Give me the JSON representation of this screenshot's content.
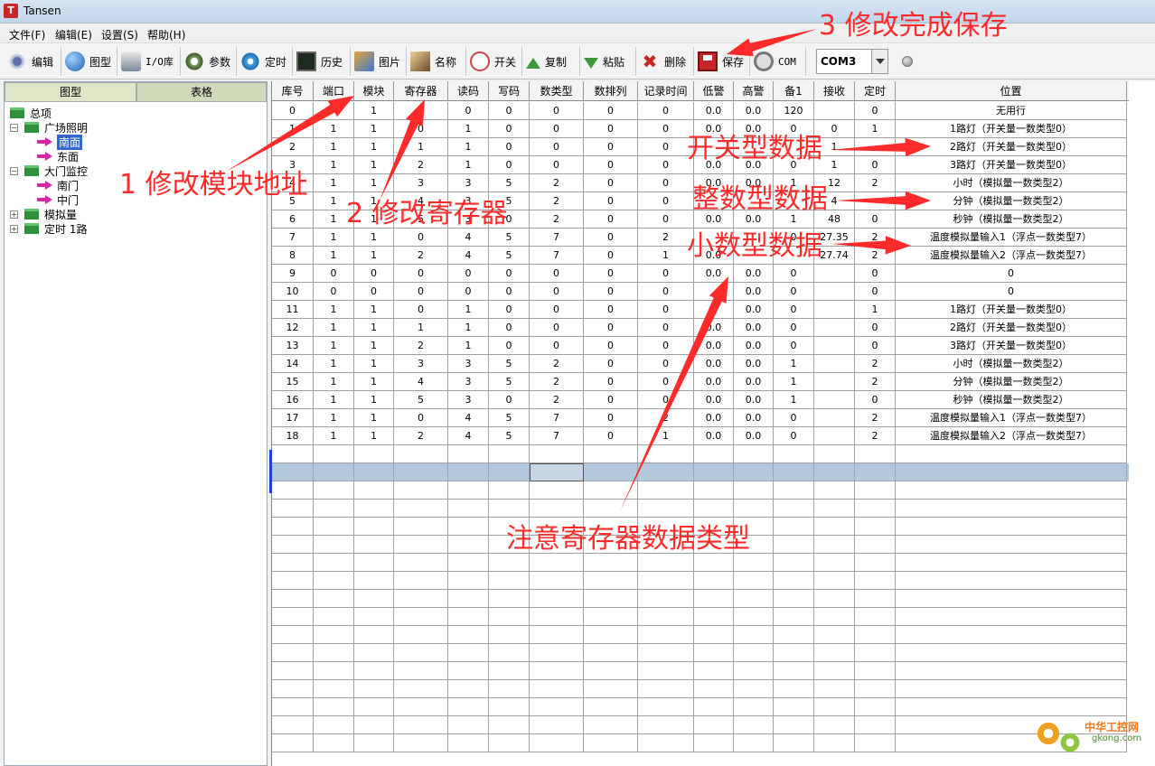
{
  "window": {
    "title": "Tansen",
    "app_icon_letter": "T"
  },
  "menu": [
    "文件(F)",
    "编辑(E)",
    "设置(S)",
    "帮助(H)"
  ],
  "toolbar": {
    "edit": "编辑",
    "diagram": "图型",
    "io_lib": "I/O库",
    "params": "参数",
    "timer": "定时",
    "history": "历史",
    "picture": "图片",
    "name": "名称",
    "switch": "开关",
    "copy": "复制",
    "paste": "粘贴",
    "delete": "删除",
    "save": "保存",
    "com": "COM",
    "com_port_value": "COM3"
  },
  "left_panel": {
    "tabs": {
      "diagram": "图型",
      "table": "表格"
    },
    "tree": {
      "root": "总项",
      "group1": "广场照明",
      "g1_child1": "南面",
      "g1_child2": "东面",
      "group2": "大门监控",
      "g2_child1": "南门",
      "g2_child2": "中门",
      "group3": "模拟量",
      "group4": "定时 1路"
    }
  },
  "table": {
    "columns": [
      "库号",
      "端口",
      "模块",
      "寄存器",
      "读码",
      "写码",
      "数类型",
      "数排列",
      "记录时间",
      "低警",
      "高警",
      "备1",
      "接收",
      "定时",
      "位置"
    ],
    "rows": [
      [
        "0",
        "",
        "1",
        "0",
        "0",
        "0",
        "0",
        "0",
        "0",
        "0.0",
        "0.0",
        "120",
        "",
        "0",
        "无用行"
      ],
      [
        "1",
        "1",
        "1",
        "0",
        "1",
        "0",
        "0",
        "0",
        "0",
        "0.0",
        "0.0",
        "0",
        "0",
        "1",
        "1路灯（开关量一数类型0）"
      ],
      [
        "2",
        "1",
        "1",
        "1",
        "1",
        "0",
        "0",
        "0",
        "0",
        "",
        "",
        "",
        "1",
        "",
        "2路灯（开关量一数类型0）"
      ],
      [
        "3",
        "1",
        "1",
        "2",
        "1",
        "0",
        "0",
        "0",
        "0",
        "0.0",
        "0.0",
        "0",
        "1",
        "0",
        "3路灯（开关量一数类型0）"
      ],
      [
        "4",
        "1",
        "1",
        "3",
        "3",
        "5",
        "2",
        "0",
        "0",
        "0.0",
        "0.0",
        "1",
        "12",
        "2",
        "小时（模拟量一数类型2）"
      ],
      [
        "5",
        "1",
        "1",
        "4",
        "3",
        "5",
        "2",
        "0",
        "0",
        "",
        "",
        "",
        "4",
        "",
        "分钟（模拟量一数类型2）"
      ],
      [
        "6",
        "1",
        "1",
        "5",
        "3",
        "0",
        "2",
        "0",
        "0",
        "0.0",
        "0.0",
        "1",
        "48",
        "0",
        "秒钟（模拟量一数类型2）"
      ],
      [
        "7",
        "1",
        "1",
        "0",
        "4",
        "5",
        "7",
        "0",
        "2",
        "",
        "",
        "0",
        "27.35",
        "2",
        "温度模拟量输入1（浮点一数类型7）"
      ],
      [
        "8",
        "1",
        "1",
        "2",
        "4",
        "5",
        "7",
        "0",
        "1",
        "0.0",
        "",
        "",
        "27.74",
        "2",
        "温度模拟量输入2（浮点一数类型7）"
      ],
      [
        "9",
        "0",
        "0",
        "0",
        "0",
        "0",
        "0",
        "0",
        "0",
        "0.0",
        "0.0",
        "0",
        "",
        "0",
        "0"
      ],
      [
        "10",
        "0",
        "0",
        "0",
        "0",
        "0",
        "0",
        "0",
        "0",
        "",
        "0.0",
        "0",
        "",
        "0",
        "0"
      ],
      [
        "11",
        "1",
        "1",
        "0",
        "1",
        "0",
        "0",
        "0",
        "0",
        "",
        "0.0",
        "0",
        "",
        "1",
        "1路灯（开关量一数类型0）"
      ],
      [
        "12",
        "1",
        "1",
        "1",
        "1",
        "0",
        "0",
        "0",
        "0",
        "0.0",
        "0.0",
        "0",
        "",
        "0",
        "2路灯（开关量一数类型0）"
      ],
      [
        "13",
        "1",
        "1",
        "2",
        "1",
        "0",
        "0",
        "0",
        "0",
        "0.0",
        "0.0",
        "0",
        "",
        "0",
        "3路灯（开关量一数类型0）"
      ],
      [
        "14",
        "1",
        "1",
        "3",
        "3",
        "5",
        "2",
        "0",
        "0",
        "0.0",
        "0.0",
        "1",
        "",
        "2",
        "小时（模拟量一数类型2）"
      ],
      [
        "15",
        "1",
        "1",
        "4",
        "3",
        "5",
        "2",
        "0",
        "0",
        "0.0",
        "0.0",
        "1",
        "",
        "2",
        "分钟（模拟量一数类型2）"
      ],
      [
        "16",
        "1",
        "1",
        "5",
        "3",
        "0",
        "2",
        "0",
        "0",
        "0.0",
        "0.0",
        "1",
        "",
        "0",
        "秒钟（模拟量一数类型2）"
      ],
      [
        "17",
        "1",
        "1",
        "0",
        "4",
        "5",
        "7",
        "0",
        "2",
        "0.0",
        "0.0",
        "0",
        "",
        "2",
        "温度模拟量输入1（浮点一数类型7）"
      ],
      [
        "18",
        "1",
        "1",
        "2",
        "4",
        "5",
        "7",
        "0",
        "1",
        "0.0",
        "0.0",
        "0",
        "",
        "2",
        "温度模拟量输入2（浮点一数类型7）"
      ]
    ]
  },
  "annotations": {
    "module_address": "1 修改模块地址",
    "register": "2 修改寄存器",
    "save_done": "3 修改完成保存",
    "switch_type": "开关型数据",
    "integer_type": "整数型数据",
    "decimal_type": "小数型数据",
    "register_type_note": "注意寄存器数据类型",
    "color": "#ff2a2a"
  },
  "watermark": {
    "cn": "中华工控网",
    "en": "gkong.com"
  }
}
